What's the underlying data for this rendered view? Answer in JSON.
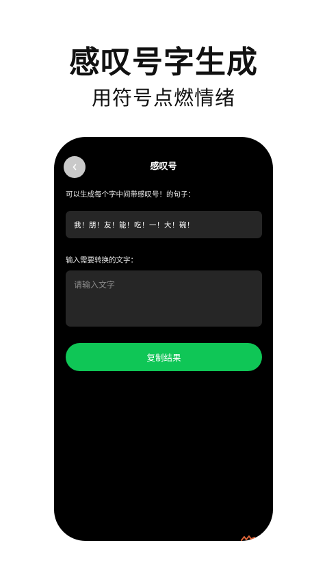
{
  "promo": {
    "title": "感叹号字生成",
    "subtitle": "用符号点燃情绪"
  },
  "screen": {
    "nav_title": "感叹号",
    "example_label": "可以生成每个字中间带感叹号！的句子：",
    "example_text": "我！朋！友！能！吃！一！大！碗！",
    "input_label": "输入需要转换的文字：",
    "input_placeholder": "请输入文字",
    "input_value": "",
    "copy_button_label": "复制结果"
  },
  "icons": {
    "back": "chevron-left-icon"
  },
  "colors": {
    "phone_background": "#000000",
    "field_background": "#262626",
    "accent_green": "#0fc656",
    "back_button": "#c9c9c9"
  }
}
